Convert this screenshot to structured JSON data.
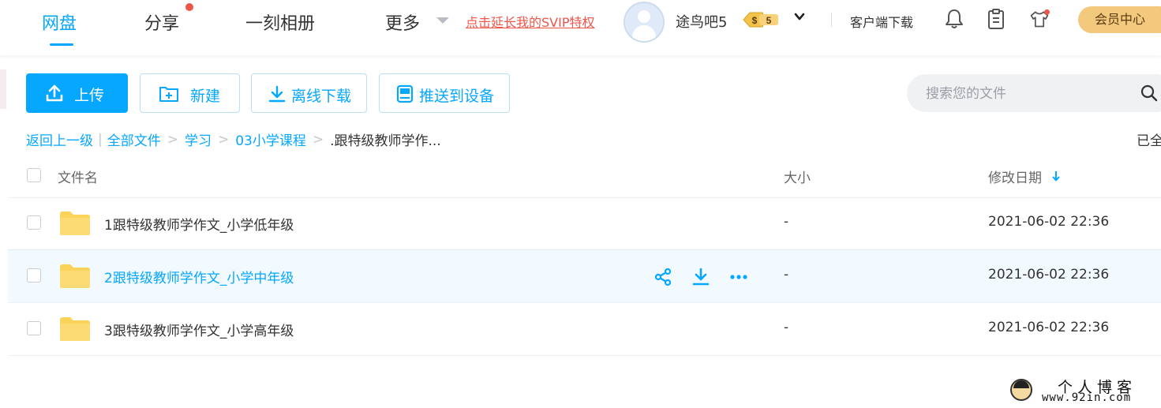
{
  "nav": {
    "tabs": [
      {
        "label": "网盘"
      },
      {
        "label": "分享"
      },
      {
        "label": "一刻相册"
      },
      {
        "label": "更多"
      }
    ],
    "promo_link": "点击延长我的SVIP特权",
    "username": "途鸟吧5",
    "vip_level": "5",
    "client_download": "客户端下载",
    "member_center": "会员中心"
  },
  "toolbar": {
    "upload": "上传",
    "new": "新建",
    "offline_download": "离线下载",
    "push_to_device": "推送到设备",
    "search_placeholder": "搜索您的文件"
  },
  "breadcrumb": {
    "back": "返回上一级",
    "items": [
      "全部文件",
      "学习",
      "03小学课程"
    ],
    "current": ".跟特级教师学作...",
    "loaded_status": "已全"
  },
  "table": {
    "headers": {
      "name": "文件名",
      "size": "大小",
      "modified": "修改日期"
    },
    "rows": [
      {
        "name": "1跟特级教师学作文_小学低年级",
        "size": "-",
        "modified": "2021-06-02 22:36"
      },
      {
        "name": "2跟特级教师学作文_小学中年级",
        "size": "-",
        "modified": "2021-06-02 22:36"
      },
      {
        "name": "3跟特级教师学作文_小学高年级",
        "size": "-",
        "modified": "2021-06-02 22:36"
      }
    ],
    "hovered_row_index": 1
  },
  "watermark": {
    "title": "个人博客",
    "url": "www.92in.com"
  },
  "colors": {
    "accent": "#06a7ff",
    "promo": "#f0554a",
    "folder": "#fcd35a",
    "member_button": "#f2c97d"
  },
  "icons": {
    "upload": "upload-icon",
    "new_folder": "new-folder-icon",
    "download": "download-icon",
    "push": "push-device-icon",
    "search": "search-icon",
    "bell": "bell-icon",
    "clipboard": "clipboard-icon",
    "shirt": "shirt-icon",
    "share": "share-icon",
    "more": "more-icon",
    "folder": "folder-icon",
    "sort": "sort-down-arrow-icon"
  }
}
